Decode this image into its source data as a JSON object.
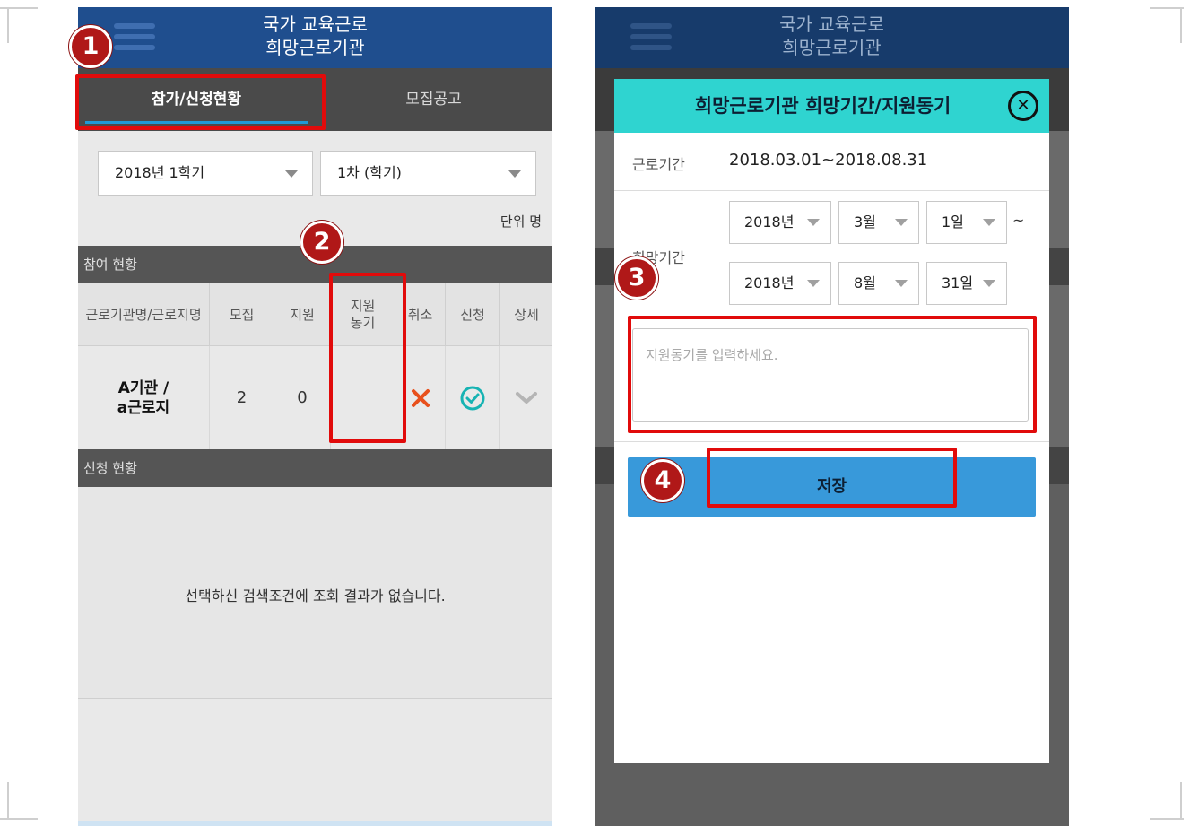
{
  "left": {
    "appbar": {
      "title_line1": "국가 교육근로",
      "title_line2": "희망근로기관"
    },
    "tabs": [
      {
        "label": "참가/신청현황",
        "active": true
      },
      {
        "label": "모집공고",
        "active": false
      }
    ],
    "filters": {
      "semester": "2018년 1학기",
      "round": "1차 (학기)"
    },
    "unit": "단위 명",
    "participation_title": "참여 현황",
    "table": {
      "headers": [
        "근로기관명/근로지명",
        "모집",
        "지원",
        "지원\n동기",
        "취소",
        "신청",
        "상세"
      ],
      "rows": [
        {
          "name_line1": "A기관 /",
          "name_line2": "a근로지",
          "recruit": "2",
          "applied": "0",
          "motive": ""
        }
      ]
    },
    "application_title": "신청 현황",
    "empty_message": "선택하신 검색조건에 조회 결과가 없습니다."
  },
  "right": {
    "appbar": {
      "title_line1": "국가 교육근로",
      "title_line2": "희망근로기관"
    },
    "modal": {
      "title": "희망근로기관 희망기간/지원동기",
      "work_period_label": "근로기간",
      "work_period_value": "2018.03.01~2018.08.31",
      "hope_period_label": "희망기간",
      "start": {
        "year": "2018년",
        "month": "3월",
        "day": "1일"
      },
      "end": {
        "year": "2018년",
        "month": "8월",
        "day": "31일"
      },
      "tilde": "~",
      "motive_placeholder": "지원동기를 입력하세요.",
      "save_label": "저장"
    }
  },
  "callouts": [
    "1",
    "2",
    "3",
    "4"
  ],
  "colors": {
    "appbar": "#1f4e8e",
    "modal_header": "#2fd4d0",
    "save_button": "#3899da",
    "highlight": "#e10b0b",
    "badge": "#b01818",
    "cancel_icon": "#e8501c",
    "check_icon": "#17b3b3"
  },
  "icons": [
    "menu-icon",
    "cancel-x-icon",
    "check-circle-icon",
    "chevron-down-icon",
    "close-icon"
  ]
}
